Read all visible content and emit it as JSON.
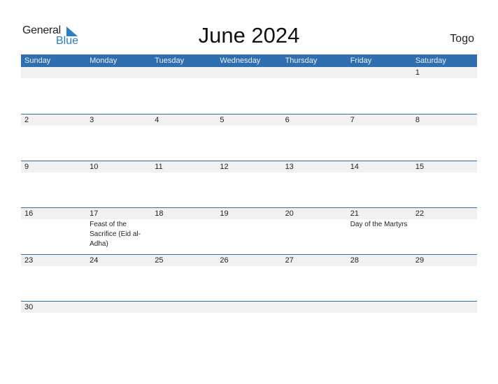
{
  "logo": {
    "general": "General",
    "blue": "Blue"
  },
  "title": "June 2024",
  "country": "Togo",
  "colors": {
    "header_bg": "#2f6fb0",
    "accent": "#2a7fc4",
    "strip": "#f1f1f1"
  },
  "weekdays": [
    "Sunday",
    "Monday",
    "Tuesday",
    "Wednesday",
    "Thursday",
    "Friday",
    "Saturday"
  ],
  "weeks": [
    [
      {
        "day": ""
      },
      {
        "day": ""
      },
      {
        "day": ""
      },
      {
        "day": ""
      },
      {
        "day": ""
      },
      {
        "day": ""
      },
      {
        "day": "1"
      }
    ],
    [
      {
        "day": "2"
      },
      {
        "day": "3"
      },
      {
        "day": "4"
      },
      {
        "day": "5"
      },
      {
        "day": "6"
      },
      {
        "day": "7"
      },
      {
        "day": "8"
      }
    ],
    [
      {
        "day": "9"
      },
      {
        "day": "10"
      },
      {
        "day": "11"
      },
      {
        "day": "12"
      },
      {
        "day": "13"
      },
      {
        "day": "14"
      },
      {
        "day": "15"
      }
    ],
    [
      {
        "day": "16"
      },
      {
        "day": "17",
        "event": "Feast of the Sacrifice (Eid al-Adha)"
      },
      {
        "day": "18"
      },
      {
        "day": "19"
      },
      {
        "day": "20"
      },
      {
        "day": "21",
        "event": "Day of the Martyrs"
      },
      {
        "day": "22"
      }
    ],
    [
      {
        "day": "23"
      },
      {
        "day": "24"
      },
      {
        "day": "25"
      },
      {
        "day": "26"
      },
      {
        "day": "27"
      },
      {
        "day": "28"
      },
      {
        "day": "29"
      }
    ],
    [
      {
        "day": "30"
      },
      {
        "day": ""
      },
      {
        "day": ""
      },
      {
        "day": ""
      },
      {
        "day": ""
      },
      {
        "day": ""
      },
      {
        "day": ""
      }
    ]
  ]
}
